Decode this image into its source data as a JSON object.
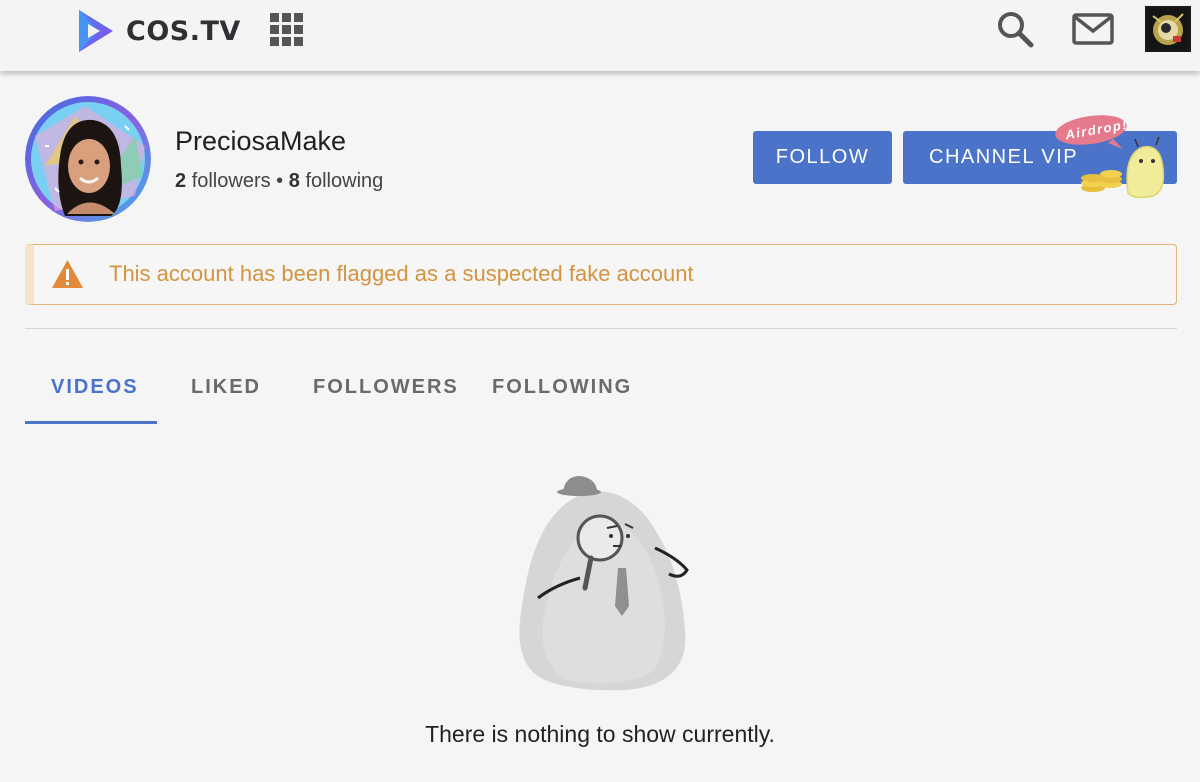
{
  "header": {
    "brand": "COS.TV",
    "icons": {
      "apps": "apps-grid-icon",
      "search": "search-icon",
      "mail": "mail-icon",
      "avatar": "user-avatar"
    }
  },
  "profile": {
    "channel_name": "PreciosaMake",
    "followers_count": "2",
    "followers_label": "followers",
    "separator": "•",
    "following_count": "8",
    "following_label": "following",
    "follow_button": "FOLLOW",
    "vip_button": "CHANNEL VIP",
    "airdrop_badge": "Airdrop!"
  },
  "warning": {
    "text": "This account has been flagged as a suspected fake account"
  },
  "tabs": [
    {
      "label": "VIDEOS",
      "active": true
    },
    {
      "label": "LIKED",
      "active": false
    },
    {
      "label": "FOLLOWERS",
      "active": false
    },
    {
      "label": "FOLLOWING",
      "active": false
    }
  ],
  "empty_state": {
    "message": "There is nothing to show currently."
  },
  "colors": {
    "accent": "#4a73c9",
    "warning": "#d3943f",
    "warning_border": "#e2b574",
    "background": "#f5f5f5"
  }
}
